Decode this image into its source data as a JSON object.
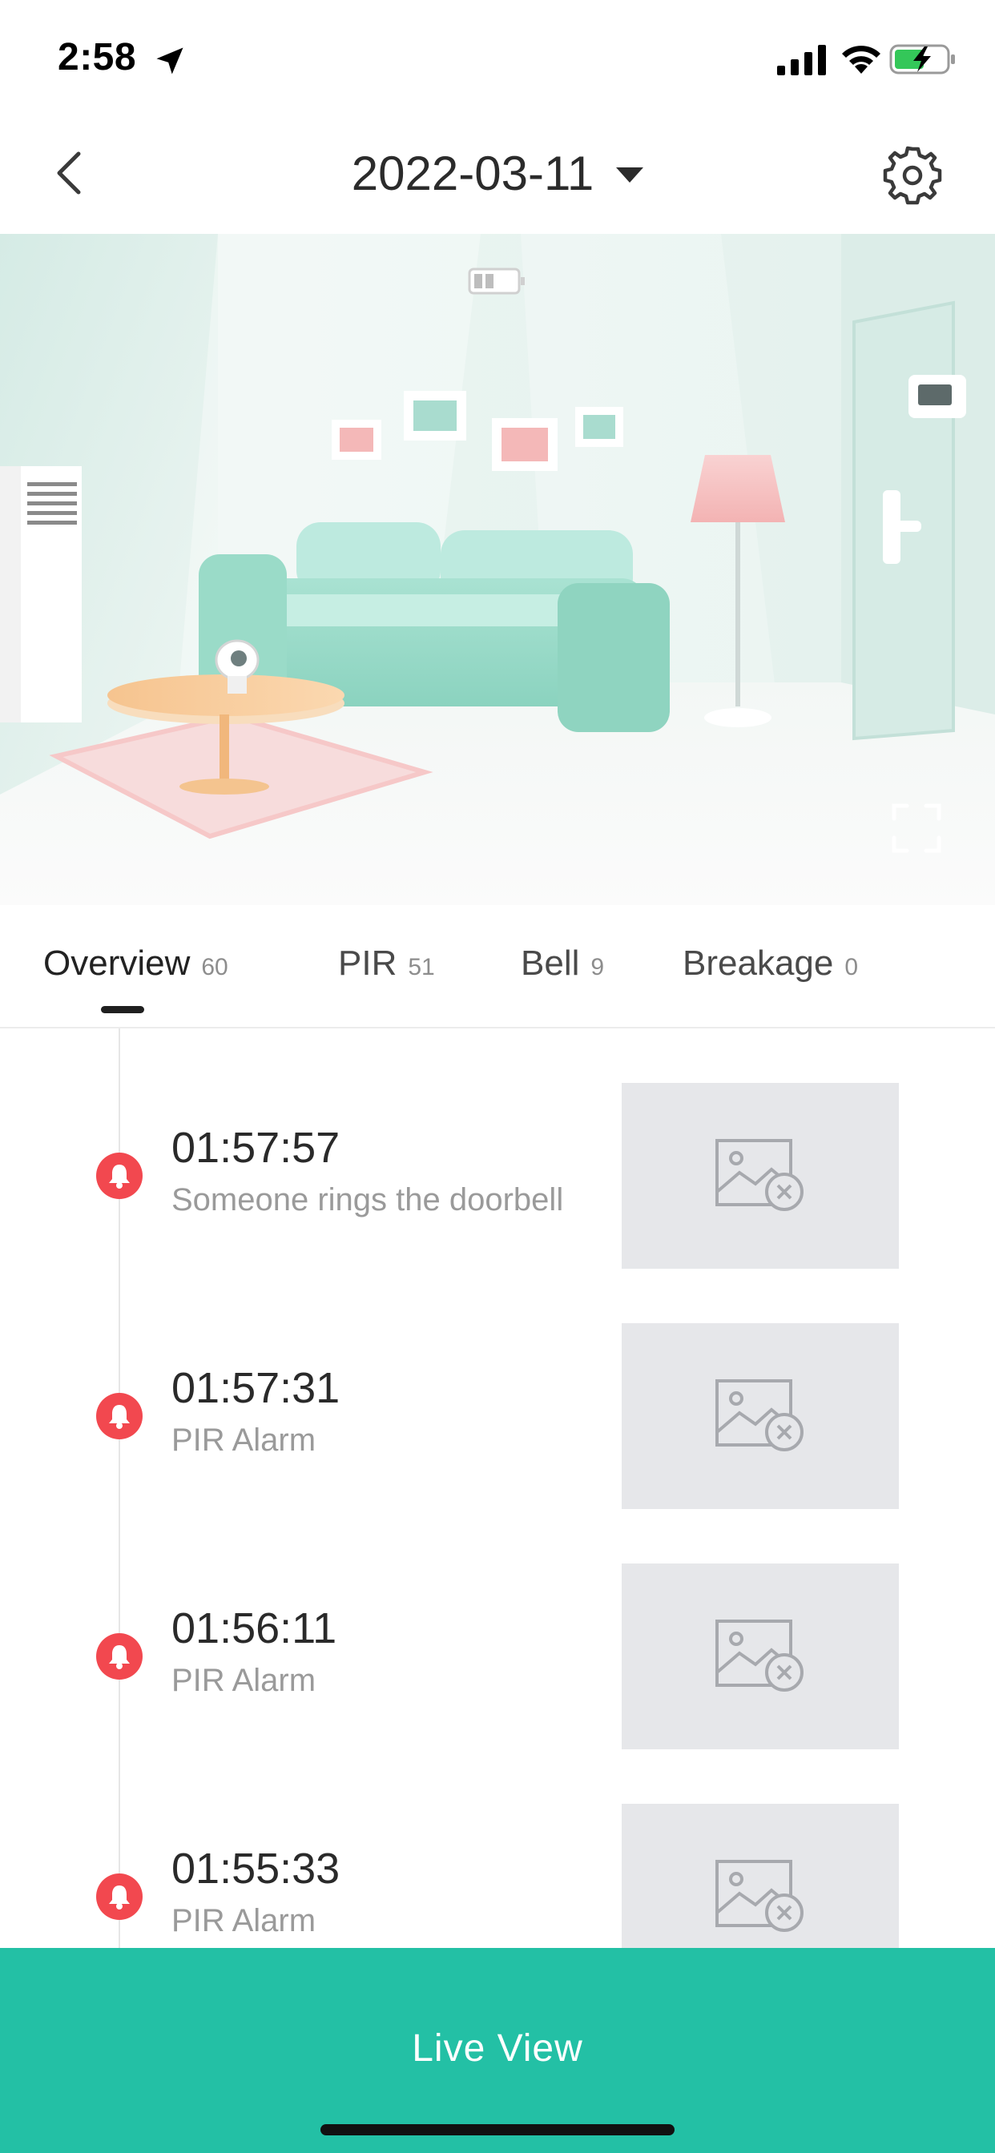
{
  "status_bar": {
    "time": "2:58",
    "icons": [
      "location-arrow-icon",
      "signal-icon",
      "wifi-icon",
      "battery-charging-icon"
    ]
  },
  "header": {
    "date": "2022-03-11",
    "icons": [
      "back-chevron-icon",
      "dropdown-caret-icon",
      "gear-icon"
    ]
  },
  "hero": {
    "overlay_icons": [
      "camera-battery-icon",
      "fullscreen-icon"
    ]
  },
  "tabs": [
    {
      "label": "Overview",
      "count": "60",
      "active": true
    },
    {
      "label": "PIR",
      "count": "51",
      "active": false
    },
    {
      "label": "Bell",
      "count": "9",
      "active": false
    },
    {
      "label": "Breakage",
      "count": "0",
      "active": false
    }
  ],
  "events": [
    {
      "time": "01:57:57",
      "desc": "Someone rings the doorbell"
    },
    {
      "time": "01:57:31",
      "desc": "PIR Alarm"
    },
    {
      "time": "01:56:11",
      "desc": "PIR Alarm"
    },
    {
      "time": "01:55:33",
      "desc": "PIR Alarm"
    }
  ],
  "bottom": {
    "live_view_label": "Live View"
  },
  "colors": {
    "accent": "#23c0a5",
    "alarm": "#f2484f",
    "thumb_bg": "#e6e7ea"
  }
}
